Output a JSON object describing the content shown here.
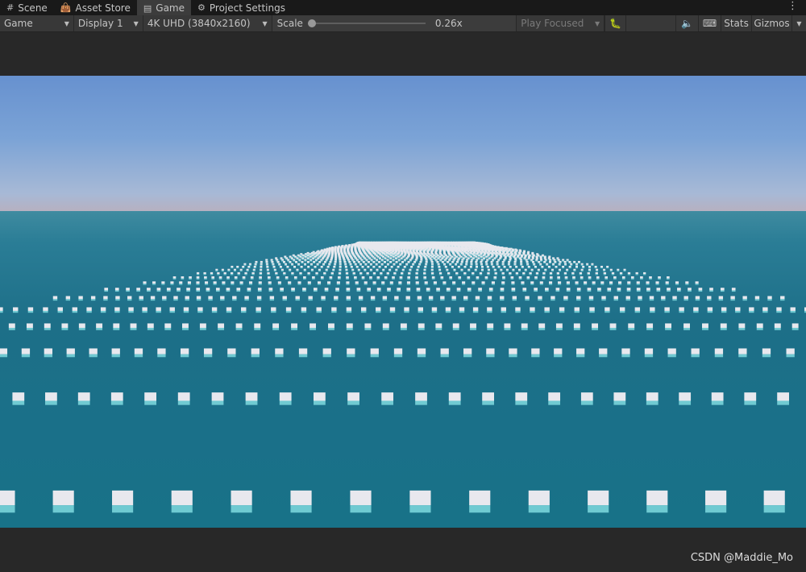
{
  "tabs": [
    {
      "label": "Scene",
      "icon": "grid-icon",
      "active": false
    },
    {
      "label": "Asset Store",
      "icon": "shopping-bag-icon",
      "active": false
    },
    {
      "label": "Game",
      "icon": "gamepad-icon",
      "active": true
    },
    {
      "label": "Project Settings",
      "icon": "gear-icon",
      "active": false
    }
  ],
  "toolbar": {
    "view_mode": "Game",
    "display": "Display 1",
    "resolution": "4K UHD (3840x2160)",
    "scale_label": "Scale",
    "scale_value": "0.26x",
    "scale_fraction": 0.0,
    "play_mode": "Play Focused",
    "stats_label": "Stats",
    "gizmos_label": "Gizmos"
  },
  "watermark": "CSDN @Maddie_Mo",
  "colors": {
    "sky": "#6791cf",
    "sea": "#1d6f88",
    "cube": "#e8e8ee",
    "cube_submerged": "#7fd9df"
  }
}
